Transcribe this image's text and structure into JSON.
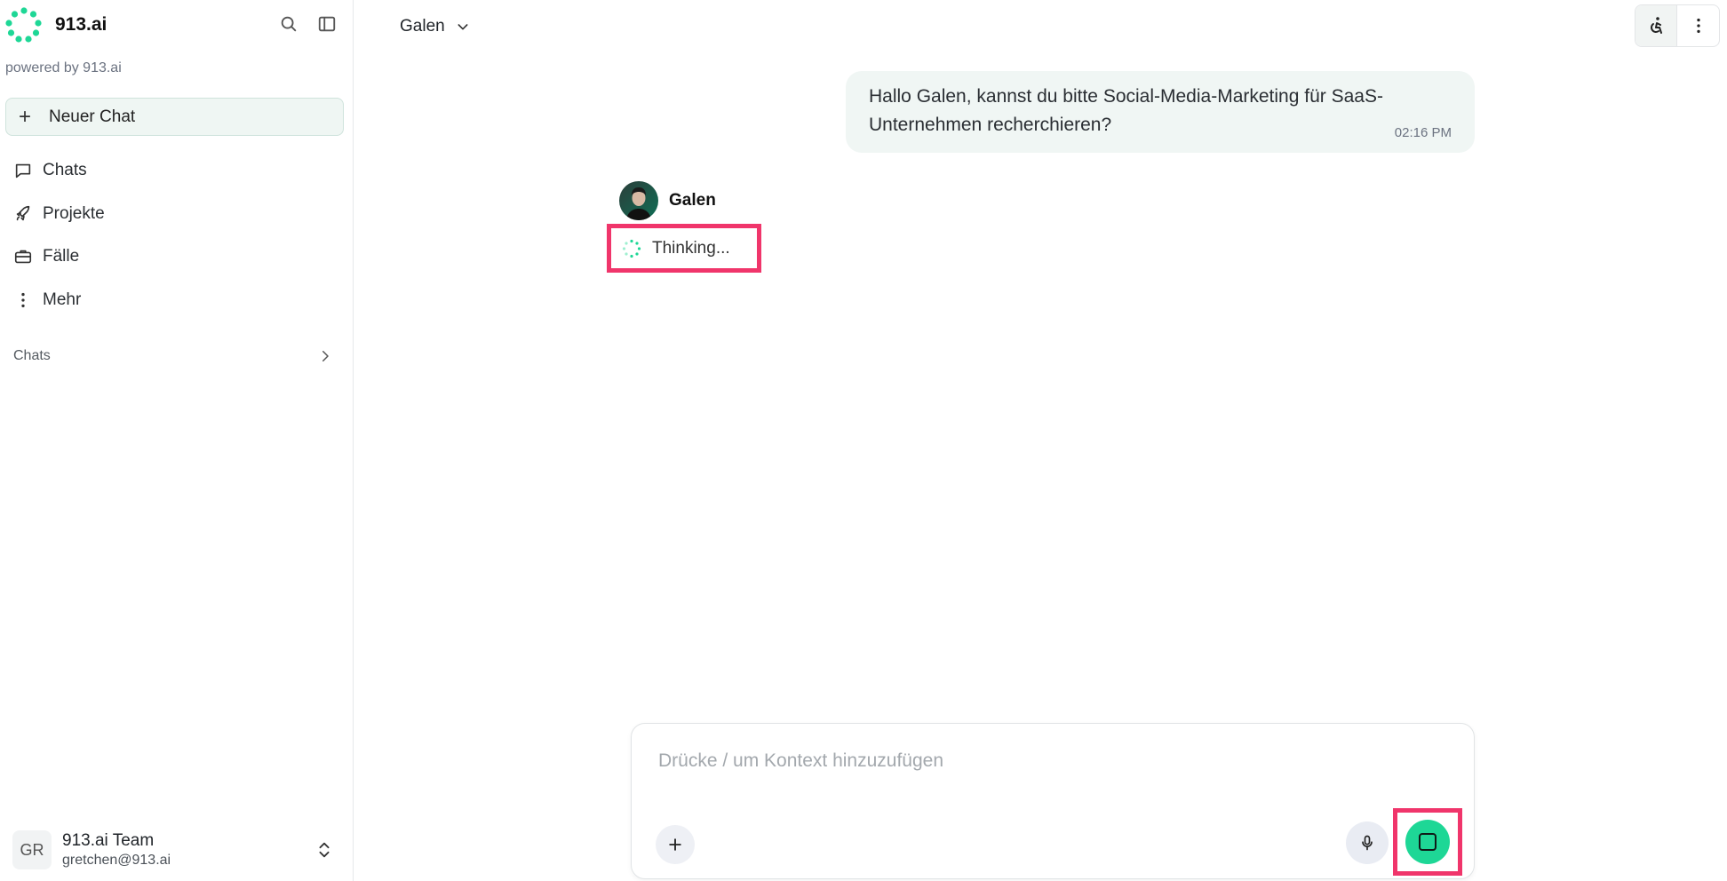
{
  "brand": {
    "name": "913.ai",
    "powered_by": "powered by 913.ai",
    "accent_color": "#1ed796"
  },
  "sidebar": {
    "new_chat_label": "Neuer Chat",
    "nav": [
      {
        "label": "Chats",
        "icon": "chat-bubble-icon"
      },
      {
        "label": "Projekte",
        "icon": "rocket-icon"
      },
      {
        "label": "Fälle",
        "icon": "briefcase-icon"
      },
      {
        "label": "Mehr",
        "icon": "more-vertical-icon"
      }
    ],
    "section_title": "Chats",
    "user": {
      "initials": "GR",
      "name": "913.ai Team",
      "email": "gretchen@913.ai"
    }
  },
  "header": {
    "agent_name": "Galen"
  },
  "conversation": {
    "user_message": {
      "text": "Hallo Galen, kannst du bitte Social-Media-Marketing für SaaS-Unternehmen recherchieren?",
      "time": "02:16 PM"
    },
    "agent": {
      "name": "Galen",
      "status": "Thinking..."
    }
  },
  "composer": {
    "placeholder": "Drücke / um Kontext hinzuzufügen"
  },
  "colors": {
    "highlight": "#f0356b",
    "user_bubble": "#f0f6f4",
    "new_chat_bg": "#eff6f3"
  }
}
